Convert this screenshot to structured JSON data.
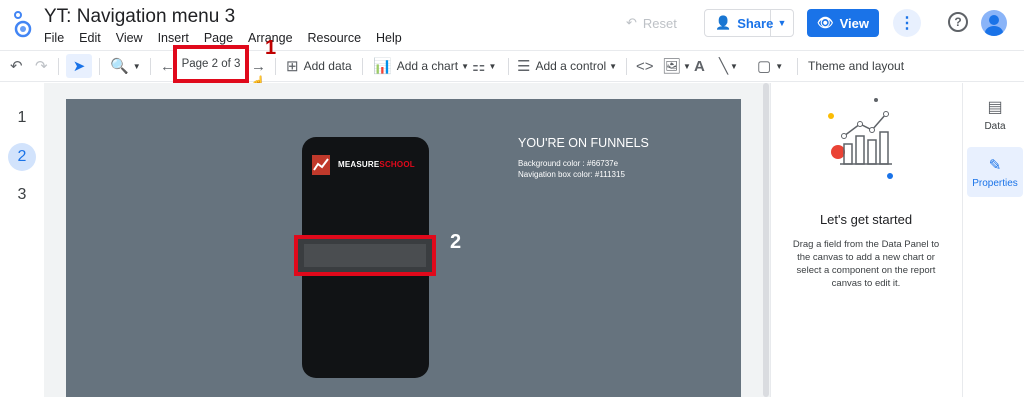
{
  "header": {
    "title": "YT: Navigation menu 3",
    "menu": [
      "File",
      "Edit",
      "View",
      "Insert",
      "Page",
      "Arrange",
      "Resource",
      "Help"
    ],
    "reset_label": "Reset",
    "share_label": "Share",
    "view_label": "View",
    "more_label": "⋮",
    "help_label": "?"
  },
  "toolbar": {
    "page_indicator": "Page 2 of 3",
    "add_data": "Add data",
    "add_chart": "Add a chart",
    "add_control": "Add a control",
    "theme_layout": "Theme and layout"
  },
  "annotations": {
    "one": "1",
    "two": "2"
  },
  "pages": [
    "1",
    "2",
    "3"
  ],
  "active_page": "2",
  "canvas": {
    "brand_prefix": "MEASURE",
    "brand_suffix": "SCHOOL",
    "funnel_title": "YOU'RE ON FUNNELS",
    "bg_color_line": "Background color : #66737e",
    "nav_color_line": "Navigation box color: #111315"
  },
  "panel": {
    "heading": "Let's get started",
    "description": "Drag a field from the Data Panel to the canvas to add a new chart or select a component on the report canvas to edit it."
  },
  "sidetabs": {
    "data": "Data",
    "properties": "Properties"
  },
  "colors": {
    "canvas": "#66737e",
    "nav_box": "#111315",
    "highlight": "#e0091b",
    "accent": "#1a73e8"
  }
}
